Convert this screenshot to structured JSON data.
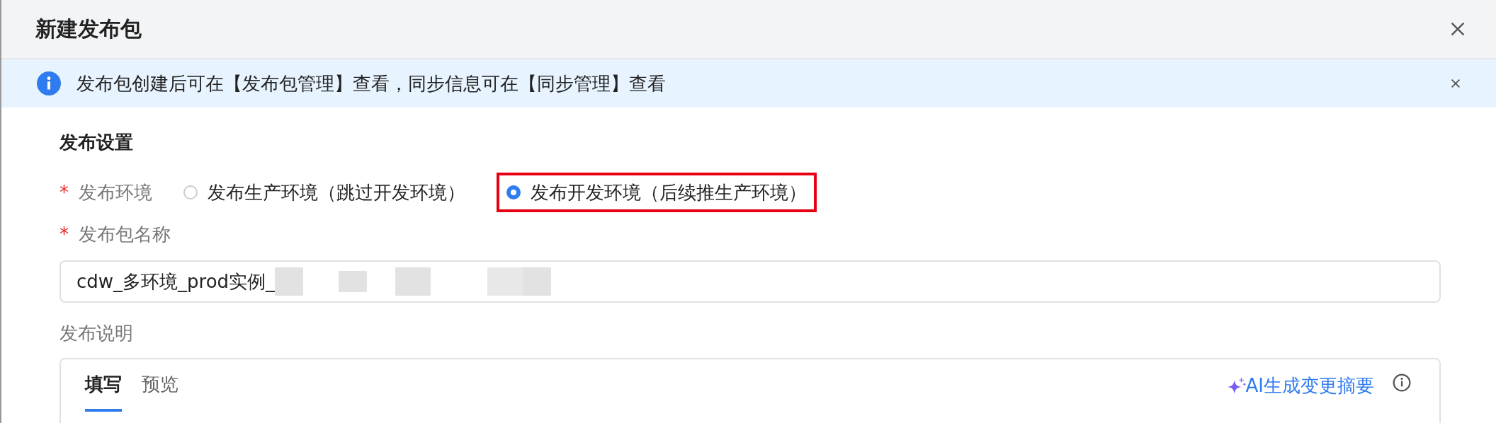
{
  "dialog": {
    "title": "新建发布包"
  },
  "alert": {
    "text": "发布包创建后可在【发布包管理】查看，同步信息可在【同步管理】查看"
  },
  "section": {
    "title": "发布设置"
  },
  "environment": {
    "label": "发布环境",
    "required_mark": "*",
    "options": [
      {
        "label": "发布生产环境（跳过开发环境）",
        "selected": false,
        "highlighted": false
      },
      {
        "label": "发布开发环境（后续推生产环境）",
        "selected": true,
        "highlighted": true
      }
    ]
  },
  "package_name": {
    "label": "发布包名称",
    "required_mark": "*",
    "value": "cdw_多环境_prod实例_"
  },
  "description": {
    "label": "发布说明",
    "tabs": [
      {
        "label": "填写",
        "selected": true
      },
      {
        "label": "预览",
        "selected": false
      }
    ],
    "ai_link": "AI生成变更摘要"
  }
}
